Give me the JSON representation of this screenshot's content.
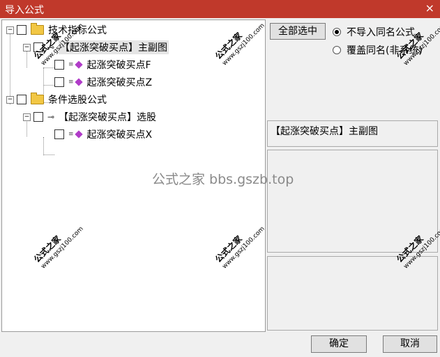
{
  "window": {
    "title": "导入公式",
    "close_icon": "×"
  },
  "tree": {
    "items": [
      {
        "label": "技术指标公式",
        "expander": "−"
      },
      {
        "label": "【起涨突破买点】主副图",
        "expander": "−"
      },
      {
        "label": "起涨突破买点F",
        "prefix": "≡"
      },
      {
        "label": "起涨突破买点Z",
        "prefix": "≡"
      },
      {
        "label": "条件选股公式",
        "expander": "−"
      },
      {
        "label": "【起涨突破买点】选股",
        "expander": "−"
      },
      {
        "label": "起涨突破买点X",
        "prefix": "≡"
      }
    ]
  },
  "options": {
    "select_all_label": "全部选中",
    "radio_no_import_label": "不导入同名公式",
    "radio_overwrite_label": "覆盖同名(非系统)",
    "selected_radio": "no_import"
  },
  "info": {
    "selected_formula": "【起涨突破买点】主副图"
  },
  "buttons": {
    "ok_label": "确定",
    "cancel_label": "取消"
  },
  "watermark": {
    "brand": "公式之家",
    "url": "www.gszj100.com",
    "center_text": "公式之家 bbs.gszb.top"
  }
}
